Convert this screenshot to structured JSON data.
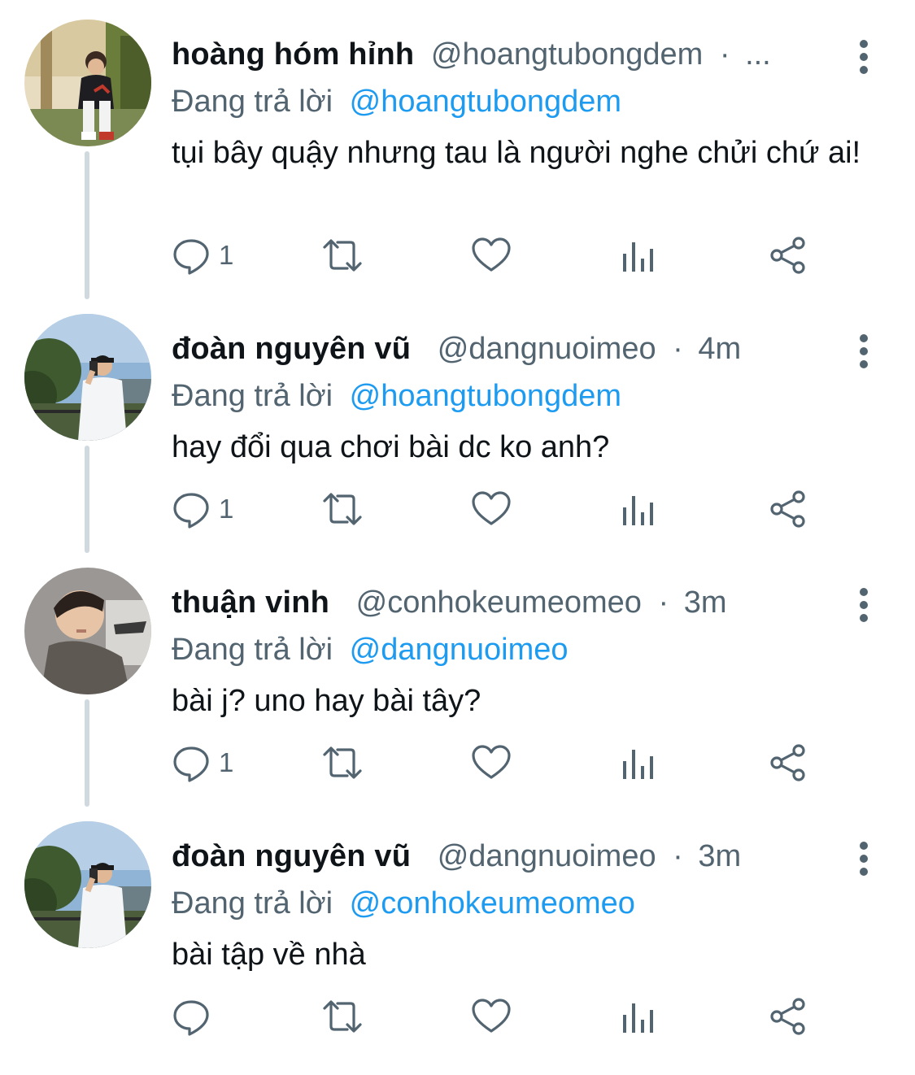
{
  "colors": {
    "text_primary": "#0f1419",
    "text_secondary": "#536471",
    "link": "#1d9bf0",
    "thread_line": "#cfd9de"
  },
  "tweets": [
    {
      "display_name": "hoàng hóm hỉnh",
      "handle": "@hoangtubongdem",
      "separator": "·",
      "time": "...",
      "reply_prefix": "Đang trả lời",
      "reply_to": "@hoangtubongdem",
      "text": "tụi bây quậy nhưng tau là người nghe chửi chứ ai!",
      "reply_count": "1",
      "avatar": "avatar-sitting-outdoors"
    },
    {
      "display_name": "đoàn nguyên vũ",
      "handle": "@dangnuoimeo",
      "separator": "·",
      "time": "4m",
      "reply_prefix": "Đang trả lời",
      "reply_to": "@hoangtubongdem",
      "text": "hay đổi qua chơi bài dc ko anh?",
      "reply_count": "1",
      "avatar": "avatar-taking-photo-park"
    },
    {
      "display_name": "thuận vinh",
      "handle": "@conhokeumeomeo",
      "separator": "·",
      "time": "3m",
      "reply_prefix": "Đang trả lời",
      "reply_to": "@dangnuoimeo",
      "text": "bài j? uno hay bài tây?",
      "reply_count": "1",
      "avatar": "avatar-selfie-indoors"
    },
    {
      "display_name": "đoàn nguyên vũ",
      "handle": "@dangnuoimeo",
      "separator": "·",
      "time": "3m",
      "reply_prefix": "Đang trả lời",
      "reply_to": "@conhokeumeomeo",
      "text": "bài tập về nhà",
      "reply_count": "",
      "avatar": "avatar-taking-photo-park"
    }
  ],
  "icons": {
    "more": "more-vertical-icon",
    "reply": "reply-bubble-icon",
    "retweet": "retweet-icon",
    "like": "heart-icon",
    "views": "views-bar-chart-icon",
    "share": "share-icon"
  }
}
